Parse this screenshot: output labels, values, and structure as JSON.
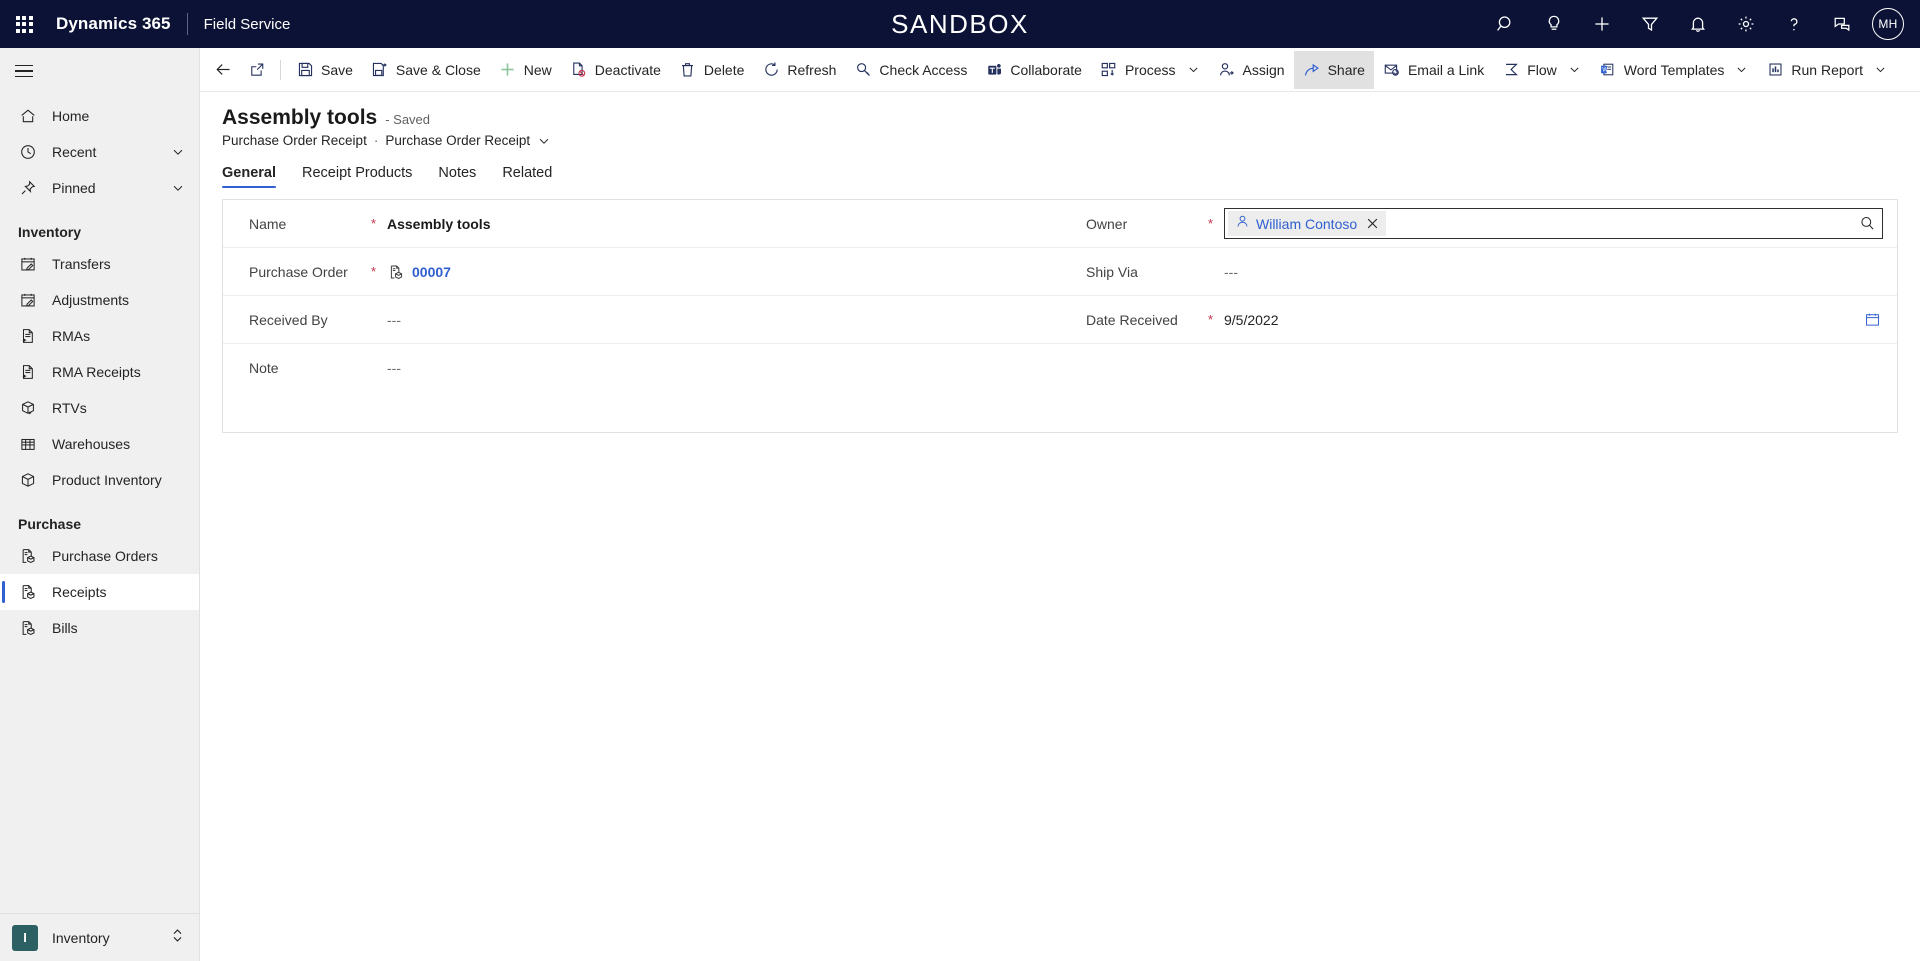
{
  "topbar": {
    "waffle_label": "app-launcher",
    "brand": "Dynamics 365",
    "app_name": "Field Service",
    "sandbox_banner": "SANDBOX",
    "icons": [
      {
        "name": "search-icon",
        "label": "Search"
      },
      {
        "name": "lightbulb-icon",
        "label": "Insights"
      },
      {
        "name": "plus-icon",
        "label": "Quick create"
      },
      {
        "name": "filter-icon",
        "label": "Filter"
      },
      {
        "name": "bell-icon",
        "label": "Notifications"
      },
      {
        "name": "gear-icon",
        "label": "Settings"
      },
      {
        "name": "question-icon",
        "label": "Help"
      },
      {
        "name": "feedback-icon",
        "label": "Feedback"
      }
    ],
    "avatar_initials": "MH"
  },
  "commandbar": {
    "back_label": "Back",
    "popout_label": "Open in new window",
    "buttons": [
      {
        "name": "save-button",
        "label": "Save",
        "icon": "save-icon",
        "caret": false,
        "active": false
      },
      {
        "name": "save-close-button",
        "label": "Save & Close",
        "icon": "save-close-icon",
        "caret": false,
        "active": false
      },
      {
        "name": "new-button",
        "label": "New",
        "icon": "plus-icon",
        "caret": false,
        "active": false
      },
      {
        "name": "deactivate-button",
        "label": "Deactivate",
        "icon": "deactivate-icon",
        "caret": false,
        "active": false
      },
      {
        "name": "delete-button",
        "label": "Delete",
        "icon": "trash-icon",
        "caret": false,
        "active": false
      },
      {
        "name": "refresh-button",
        "label": "Refresh",
        "icon": "refresh-icon",
        "caret": false,
        "active": false
      },
      {
        "name": "check-access-button",
        "label": "Check Access",
        "icon": "key-icon",
        "caret": false,
        "active": false
      },
      {
        "name": "collaborate-button",
        "label": "Collaborate",
        "icon": "teams-icon",
        "caret": false,
        "active": false
      },
      {
        "name": "process-button",
        "label": "Process",
        "icon": "process-icon",
        "caret": true,
        "active": false
      },
      {
        "name": "assign-button",
        "label": "Assign",
        "icon": "assign-icon",
        "caret": false,
        "active": false
      },
      {
        "name": "share-button",
        "label": "Share",
        "icon": "share-icon",
        "caret": false,
        "active": true
      },
      {
        "name": "email-link-button",
        "label": "Email a Link",
        "icon": "email-icon",
        "caret": false,
        "active": false
      },
      {
        "name": "flow-button",
        "label": "Flow",
        "icon": "flow-icon",
        "caret": true,
        "active": false
      },
      {
        "name": "word-templates-button",
        "label": "Word Templates",
        "icon": "word-icon",
        "caret": true,
        "active": false
      },
      {
        "name": "run-report-button",
        "label": "Run Report",
        "icon": "report-icon",
        "caret": true,
        "active": false
      }
    ]
  },
  "page": {
    "title": "Assembly tools",
    "save_state": "- Saved",
    "breadcrumb_entity": "Purchase Order Receipt",
    "breadcrumb_separator": "·",
    "breadcrumb_form": "Purchase Order Receipt"
  },
  "tabs": [
    {
      "name": "tab-general",
      "label": "General",
      "active": true
    },
    {
      "name": "tab-receipt-products",
      "label": "Receipt Products",
      "active": false
    },
    {
      "name": "tab-notes",
      "label": "Notes",
      "active": false
    },
    {
      "name": "tab-related",
      "label": "Related",
      "active": false
    }
  ],
  "form": {
    "left": [
      {
        "name": "field-name",
        "label": "Name",
        "required": true,
        "value": "Assembly tools",
        "style": "bold"
      },
      {
        "name": "field-purchase-order",
        "label": "Purchase Order",
        "required": true,
        "value": "00007",
        "style": "lookup-link",
        "icon": "purchase-order-record-icon"
      },
      {
        "name": "field-received-by",
        "label": "Received By",
        "required": false,
        "value": "---",
        "style": "empty"
      },
      {
        "name": "field-note",
        "label": "Note",
        "required": false,
        "value": "---",
        "style": "empty"
      }
    ],
    "right": [
      {
        "name": "field-owner",
        "label": "Owner",
        "required": true,
        "value": "William Contoso",
        "style": "lookup-active"
      },
      {
        "name": "field-ship-via",
        "label": "Ship Via",
        "required": false,
        "value": "---",
        "style": "empty"
      },
      {
        "name": "field-date-received",
        "label": "Date Received",
        "required": true,
        "value": "9/5/2022",
        "style": "date"
      }
    ]
  },
  "sidebar": {
    "menu_label": "Site map",
    "primary": [
      {
        "name": "sidebar-item-home",
        "label": "Home",
        "icon": "home-icon",
        "caret": false,
        "selected": false
      },
      {
        "name": "sidebar-item-recent",
        "label": "Recent",
        "icon": "clock-icon",
        "caret": true,
        "selected": false
      },
      {
        "name": "sidebar-item-pinned",
        "label": "Pinned",
        "icon": "pin-icon",
        "caret": true,
        "selected": false
      }
    ],
    "groups": [
      {
        "name": "sidebar-group-inventory",
        "title": "Inventory",
        "items": [
          {
            "name": "sidebar-item-transfers",
            "label": "Transfers",
            "icon": "calendar-edit-icon",
            "selected": false
          },
          {
            "name": "sidebar-item-adjustments",
            "label": "Adjustments",
            "icon": "calendar-edit-icon",
            "selected": false
          },
          {
            "name": "sidebar-item-rmas",
            "label": "RMAs",
            "icon": "doc-return-icon",
            "selected": false
          },
          {
            "name": "sidebar-item-rma-receipts",
            "label": "RMA Receipts",
            "icon": "doc-return-icon",
            "selected": false
          },
          {
            "name": "sidebar-item-rtvs",
            "label": "RTVs",
            "icon": "box-return-icon",
            "selected": false
          },
          {
            "name": "sidebar-item-warehouses",
            "label": "Warehouses",
            "icon": "building-icon",
            "selected": false
          },
          {
            "name": "sidebar-item-product-inventory",
            "label": "Product Inventory",
            "icon": "box-icon",
            "selected": false
          }
        ]
      },
      {
        "name": "sidebar-group-purchase",
        "title": "Purchase",
        "items": [
          {
            "name": "sidebar-item-purchase-orders",
            "label": "Purchase Orders",
            "icon": "doc-box-icon",
            "selected": false
          },
          {
            "name": "sidebar-item-receipts",
            "label": "Receipts",
            "icon": "doc-box-icon",
            "selected": true
          },
          {
            "name": "sidebar-item-bills",
            "label": "Bills",
            "icon": "doc-box-icon",
            "selected": false
          }
        ]
      }
    ],
    "area_switcher": {
      "badge": "I",
      "label": "Inventory"
    }
  },
  "colors": {
    "topbar_bg": "#0b1235",
    "accent_blue": "#2f5fd0",
    "required_red": "#c4314b",
    "sidebar_bg": "#f0f0f0",
    "area_badge": "#2d6063"
  }
}
